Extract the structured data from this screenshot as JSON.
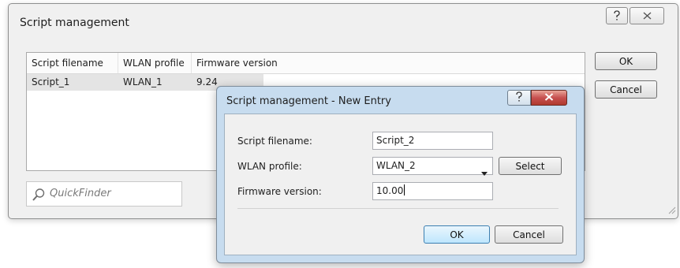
{
  "main_window": {
    "title": "Script management",
    "help_label": "?",
    "columns": [
      "Script filename",
      "WLAN profile",
      "Firmware version"
    ],
    "rows": [
      {
        "script": "Script_1",
        "profile": "WLAN_1",
        "firmware": "9.24"
      }
    ],
    "quickfinder_placeholder": "QuickFinder",
    "ok_label": "OK",
    "cancel_label": "Cancel"
  },
  "dialog": {
    "title": "Script management - New Entry",
    "help_label": "?",
    "script_label": "Script filename:",
    "script_value": "Script_2",
    "profile_label": "WLAN profile:",
    "profile_value": "WLAN_2",
    "select_label": "Select",
    "firmware_label": "Firmware version:",
    "firmware_value": "10.00",
    "ok_label": "OK",
    "cancel_label": "Cancel"
  },
  "icons": {
    "help": "help-icon",
    "close": "close-icon",
    "search": "search-icon",
    "dropdown": "chevron-down-icon",
    "resize": "resize-grip-icon"
  },
  "colors": {
    "window_bg": "#f0f0f0",
    "dialog_frame": "#c7dcef",
    "close_button": "#c75050",
    "selected_row": "#e4e4e4"
  }
}
